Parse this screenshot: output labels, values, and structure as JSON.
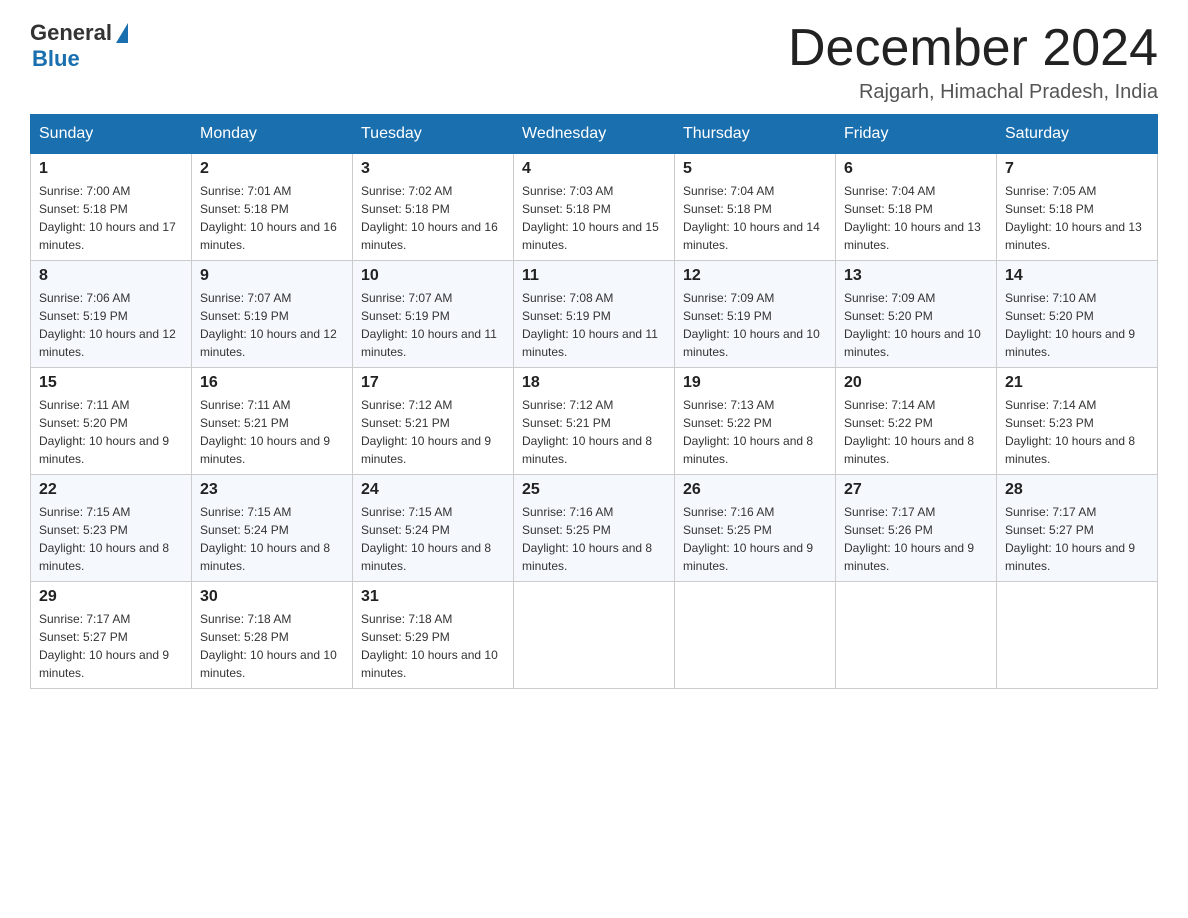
{
  "header": {
    "logo_general": "General",
    "logo_blue": "Blue",
    "month_title": "December 2024",
    "location": "Rajgarh, Himachal Pradesh, India"
  },
  "days_of_week": [
    "Sunday",
    "Monday",
    "Tuesday",
    "Wednesday",
    "Thursday",
    "Friday",
    "Saturday"
  ],
  "weeks": [
    [
      {
        "day": "1",
        "sunrise": "7:00 AM",
        "sunset": "5:18 PM",
        "daylight": "10 hours and 17 minutes."
      },
      {
        "day": "2",
        "sunrise": "7:01 AM",
        "sunset": "5:18 PM",
        "daylight": "10 hours and 16 minutes."
      },
      {
        "day": "3",
        "sunrise": "7:02 AM",
        "sunset": "5:18 PM",
        "daylight": "10 hours and 16 minutes."
      },
      {
        "day": "4",
        "sunrise": "7:03 AM",
        "sunset": "5:18 PM",
        "daylight": "10 hours and 15 minutes."
      },
      {
        "day": "5",
        "sunrise": "7:04 AM",
        "sunset": "5:18 PM",
        "daylight": "10 hours and 14 minutes."
      },
      {
        "day": "6",
        "sunrise": "7:04 AM",
        "sunset": "5:18 PM",
        "daylight": "10 hours and 13 minutes."
      },
      {
        "day": "7",
        "sunrise": "7:05 AM",
        "sunset": "5:18 PM",
        "daylight": "10 hours and 13 minutes."
      }
    ],
    [
      {
        "day": "8",
        "sunrise": "7:06 AM",
        "sunset": "5:19 PM",
        "daylight": "10 hours and 12 minutes."
      },
      {
        "day": "9",
        "sunrise": "7:07 AM",
        "sunset": "5:19 PM",
        "daylight": "10 hours and 12 minutes."
      },
      {
        "day": "10",
        "sunrise": "7:07 AM",
        "sunset": "5:19 PM",
        "daylight": "10 hours and 11 minutes."
      },
      {
        "day": "11",
        "sunrise": "7:08 AM",
        "sunset": "5:19 PM",
        "daylight": "10 hours and 11 minutes."
      },
      {
        "day": "12",
        "sunrise": "7:09 AM",
        "sunset": "5:19 PM",
        "daylight": "10 hours and 10 minutes."
      },
      {
        "day": "13",
        "sunrise": "7:09 AM",
        "sunset": "5:20 PM",
        "daylight": "10 hours and 10 minutes."
      },
      {
        "day": "14",
        "sunrise": "7:10 AM",
        "sunset": "5:20 PM",
        "daylight": "10 hours and 9 minutes."
      }
    ],
    [
      {
        "day": "15",
        "sunrise": "7:11 AM",
        "sunset": "5:20 PM",
        "daylight": "10 hours and 9 minutes."
      },
      {
        "day": "16",
        "sunrise": "7:11 AM",
        "sunset": "5:21 PM",
        "daylight": "10 hours and 9 minutes."
      },
      {
        "day": "17",
        "sunrise": "7:12 AM",
        "sunset": "5:21 PM",
        "daylight": "10 hours and 9 minutes."
      },
      {
        "day": "18",
        "sunrise": "7:12 AM",
        "sunset": "5:21 PM",
        "daylight": "10 hours and 8 minutes."
      },
      {
        "day": "19",
        "sunrise": "7:13 AM",
        "sunset": "5:22 PM",
        "daylight": "10 hours and 8 minutes."
      },
      {
        "day": "20",
        "sunrise": "7:14 AM",
        "sunset": "5:22 PM",
        "daylight": "10 hours and 8 minutes."
      },
      {
        "day": "21",
        "sunrise": "7:14 AM",
        "sunset": "5:23 PM",
        "daylight": "10 hours and 8 minutes."
      }
    ],
    [
      {
        "day": "22",
        "sunrise": "7:15 AM",
        "sunset": "5:23 PM",
        "daylight": "10 hours and 8 minutes."
      },
      {
        "day": "23",
        "sunrise": "7:15 AM",
        "sunset": "5:24 PM",
        "daylight": "10 hours and 8 minutes."
      },
      {
        "day": "24",
        "sunrise": "7:15 AM",
        "sunset": "5:24 PM",
        "daylight": "10 hours and 8 minutes."
      },
      {
        "day": "25",
        "sunrise": "7:16 AM",
        "sunset": "5:25 PM",
        "daylight": "10 hours and 8 minutes."
      },
      {
        "day": "26",
        "sunrise": "7:16 AM",
        "sunset": "5:25 PM",
        "daylight": "10 hours and 9 minutes."
      },
      {
        "day": "27",
        "sunrise": "7:17 AM",
        "sunset": "5:26 PM",
        "daylight": "10 hours and 9 minutes."
      },
      {
        "day": "28",
        "sunrise": "7:17 AM",
        "sunset": "5:27 PM",
        "daylight": "10 hours and 9 minutes."
      }
    ],
    [
      {
        "day": "29",
        "sunrise": "7:17 AM",
        "sunset": "5:27 PM",
        "daylight": "10 hours and 9 minutes."
      },
      {
        "day": "30",
        "sunrise": "7:18 AM",
        "sunset": "5:28 PM",
        "daylight": "10 hours and 10 minutes."
      },
      {
        "day": "31",
        "sunrise": "7:18 AM",
        "sunset": "5:29 PM",
        "daylight": "10 hours and 10 minutes."
      },
      null,
      null,
      null,
      null
    ]
  ],
  "labels": {
    "sunrise": "Sunrise:",
    "sunset": "Sunset:",
    "daylight": "Daylight:"
  }
}
